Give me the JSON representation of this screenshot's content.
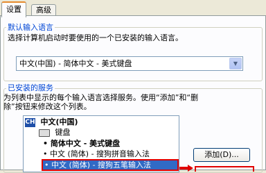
{
  "tabs": [
    {
      "label": "设置",
      "active": true
    },
    {
      "label": "高级",
      "active": false
    }
  ],
  "default_language": {
    "title": "默认输入语言",
    "description": "选择计算机启动时要使用的一个已安装的输入语言。",
    "selected": "中文(中国) - 简体中文 - 美式键盘"
  },
  "installed_services": {
    "title": "已安装的服务",
    "description_line1": "为列表中显示的每个输入语言选择服务。使用“添加”和“删",
    "description_line2": "除”按钮来修改这个列表。",
    "language_badge": "CH",
    "language": "中文(中国)",
    "category": "键盘",
    "items": [
      "简体中文 - 美式键盘",
      "中文 (简体) - 搜狗拼音输入法",
      "中文 (简体) - 搜狗五笔输入法"
    ],
    "selected_index": 2,
    "add_button": "添加(D)..."
  },
  "colors": {
    "group_title": "#0046d5",
    "selection": "#316ac5",
    "highlight_border": "#e00000",
    "active_tab_accent": "#e68b2c"
  },
  "icons": [
    "combo-arrow-icon",
    "language-badge-icon",
    "keyboard-icon",
    "arrow-right-icon"
  ]
}
